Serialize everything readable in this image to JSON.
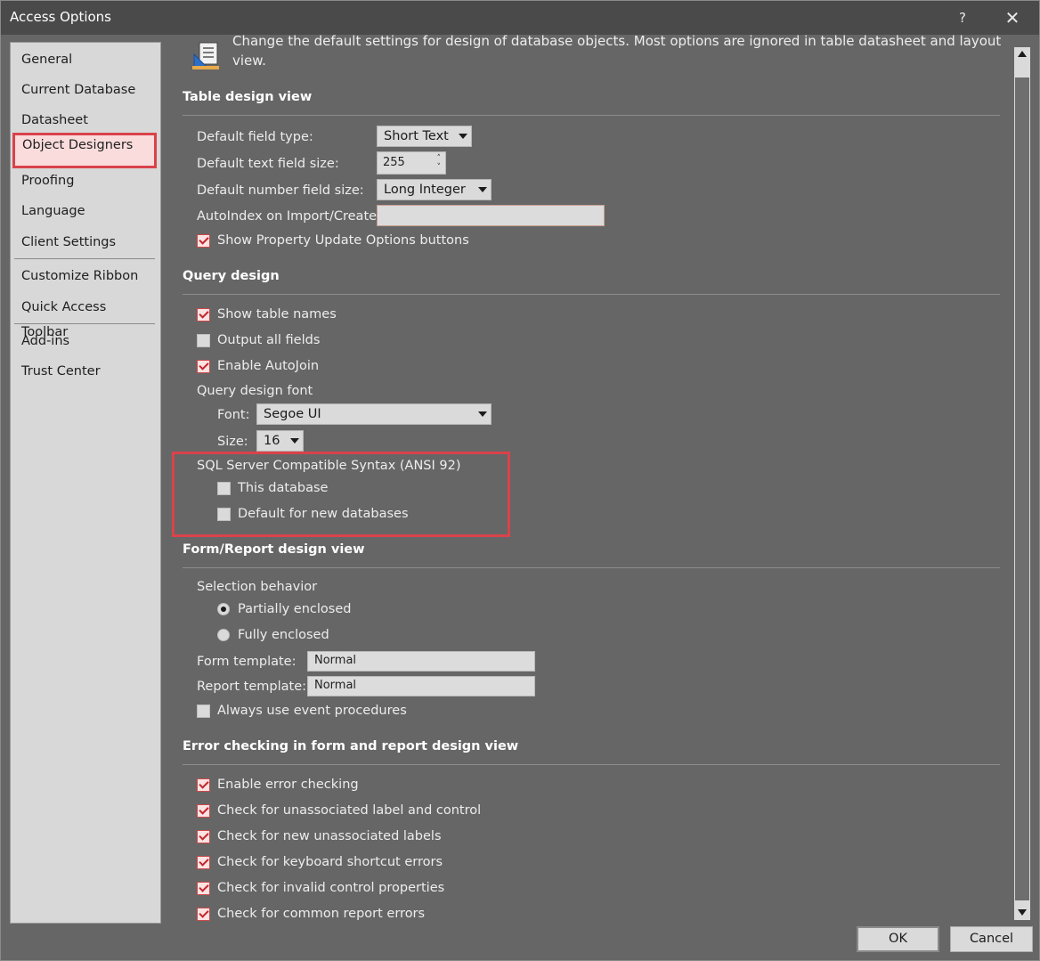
{
  "window": {
    "title": "Access Options",
    "help_glyph": "?",
    "close_glyph": "✕"
  },
  "nav": {
    "items": [
      {
        "label": "General"
      },
      {
        "label": "Current Database"
      },
      {
        "label": "Datasheet"
      },
      {
        "label": "Object Designers",
        "selected": true
      },
      {
        "label": "Proofing"
      },
      {
        "label": "Language"
      },
      {
        "label": "Client Settings"
      },
      {
        "label": "Customize Ribbon"
      },
      {
        "label": "Quick Access Toolbar"
      },
      {
        "label": "Add-ins"
      },
      {
        "label": "Trust Center"
      }
    ]
  },
  "intro": {
    "line1": "Change the default settings for design of database objects. Most options are ignored in table datasheet and layout",
    "line2": "view."
  },
  "table_design": {
    "heading": "Table design view",
    "default_field_type_label": "Default field type:",
    "default_field_type_value": "Short Text",
    "default_text_size_label": "Default text field size:",
    "default_text_size_value": "255",
    "default_number_size_label": "Default number field size:",
    "default_number_size_value": "Long Integer",
    "autoindex_label": "AutoIndex on Import/Create:",
    "autoindex_value": "",
    "show_property_update": {
      "label": "Show Property Update Options buttons",
      "checked": true
    }
  },
  "query_design": {
    "heading": "Query design",
    "show_table_names": {
      "label": "Show table names",
      "checked": true
    },
    "output_all_fields": {
      "label": "Output all fields",
      "checked": false
    },
    "enable_autojoin": {
      "label": "Enable AutoJoin",
      "checked": true
    },
    "font_group_label": "Query design font",
    "font_label": "Font:",
    "font_value": "Segoe UI",
    "size_label": "Size:",
    "size_value": "16",
    "sql_label": "SQL Server Compatible Syntax (ANSI 92)",
    "this_database": {
      "label": "This database",
      "checked": false
    },
    "default_new_db": {
      "label": "Default for new databases",
      "checked": false
    }
  },
  "form_report": {
    "heading": "Form/Report design view",
    "selection_behavior_label": "Selection behavior",
    "partially_enclosed": {
      "label": "Partially enclosed",
      "selected": true
    },
    "fully_enclosed": {
      "label": "Fully enclosed",
      "selected": false
    },
    "form_template_label": "Form template:",
    "form_template_value": "Normal",
    "report_template_label": "Report template:",
    "report_template_value": "Normal",
    "always_event_procs": {
      "label": "Always use event procedures",
      "checked": false
    }
  },
  "error_checking": {
    "heading": "Error checking in form and report design view",
    "items": [
      {
        "label": "Enable error checking",
        "checked": true
      },
      {
        "label": "Check for unassociated label and control",
        "checked": true
      },
      {
        "label": "Check for new unassociated labels",
        "checked": true
      },
      {
        "label": "Check for keyboard shortcut errors",
        "checked": true
      },
      {
        "label": "Check for invalid control properties",
        "checked": true
      },
      {
        "label": "Check for common report errors",
        "checked": true
      }
    ]
  },
  "buttons": {
    "ok": "OK",
    "cancel": "Cancel"
  },
  "colors": {
    "highlight_red": "#d9434a",
    "check_red": "#c0262c"
  }
}
